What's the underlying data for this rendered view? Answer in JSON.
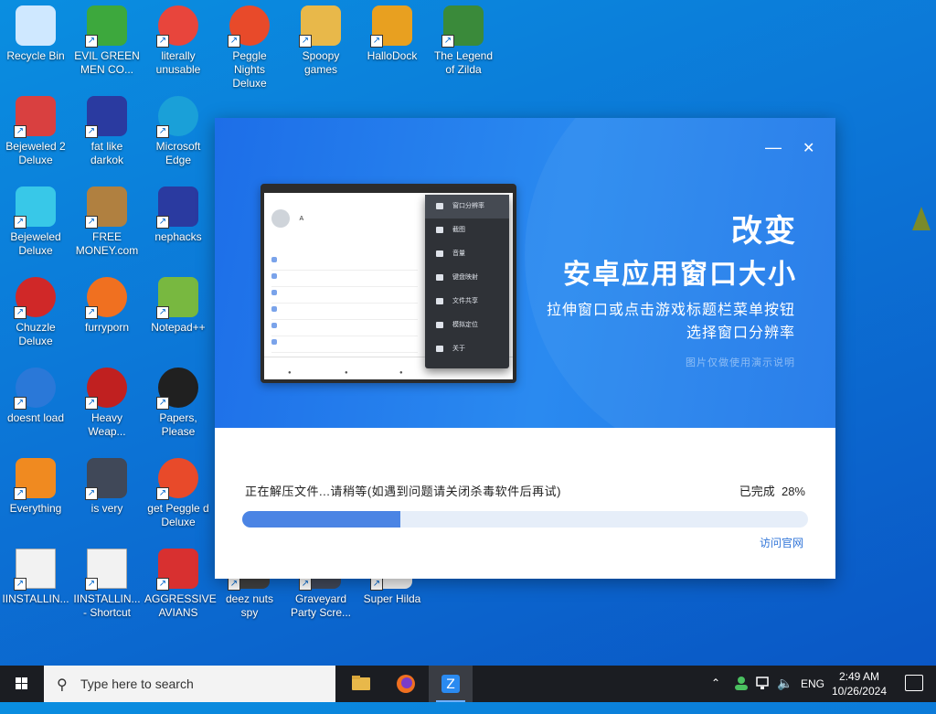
{
  "desktop_icons": [
    {
      "label": "Recycle Bin",
      "icon": "recycle-bin-icon",
      "color": "#cfe8ff"
    },
    {
      "label": "EVIL GREEN MEN CO...",
      "icon": "green-men-icon",
      "color": "#3da83d"
    },
    {
      "label": "literally unusable",
      "icon": "chrome-icon",
      "color": "#e8453c"
    },
    {
      "label": "Peggle Nights Deluxe",
      "icon": "peggle-icon",
      "color": "#e84a2a"
    },
    {
      "label": "Spoopy games",
      "icon": "folder-icon",
      "color": "#e8b84a"
    },
    {
      "label": "HalloDock",
      "icon": "shield-icon",
      "color": "#e8a020"
    },
    {
      "label": "The Legend of Zilda",
      "icon": "zelda-icon",
      "color": "#3a8a3a"
    },
    {
      "label": "Bejeweled 2 Deluxe",
      "icon": "bejeweled2-icon",
      "color": "#d94040"
    },
    {
      "label": "fat like darkok",
      "icon": "mpi-icon",
      "color": "#2a3aa0"
    },
    {
      "label": "Microsoft Edge",
      "icon": "edge-icon",
      "color": "#1aa0d8"
    },
    {
      "label": "Bejeweled Deluxe",
      "icon": "gem-icon",
      "color": "#38c8e8"
    },
    {
      "label": "FREE MONEY.com",
      "icon": "money-bag-icon",
      "color": "#b08040"
    },
    {
      "label": "nephacks",
      "icon": "mpi-icon",
      "color": "#2a3aa0"
    },
    {
      "label": "Chuzzle Deluxe",
      "icon": "chuzzle-icon",
      "color": "#d02828"
    },
    {
      "label": "furryporn",
      "icon": "firefox-icon",
      "color": "#f07020"
    },
    {
      "label": "Notepad++",
      "icon": "notepadpp-icon",
      "color": "#78b840"
    },
    {
      "label": "doesnt load",
      "icon": "thunderbird-icon",
      "color": "#2a78d8"
    },
    {
      "label": "Heavy Weap...",
      "icon": "radiation-icon",
      "color": "#c02020"
    },
    {
      "label": "Papers, Please",
      "icon": "papers-please-icon",
      "color": "#202020"
    },
    {
      "label": "Everything",
      "icon": "search-magnifier-icon",
      "color": "#f08a20"
    },
    {
      "label": "is very",
      "icon": "mpi-shield-icon",
      "color": "#404858"
    },
    {
      "label": "get Peggle d Deluxe",
      "icon": "peggle-icon",
      "color": "#e84a2a"
    },
    {
      "label": "IINSTALLIN...",
      "icon": "text-file-icon",
      "color": "#f2f2f2"
    },
    {
      "label": "IINSTALLIN... - Shortcut",
      "icon": "text-file-icon",
      "color": "#f2f2f2"
    },
    {
      "label": "AGGRESSIVE AVIANS",
      "icon": "angry-bird-icon",
      "color": "#d83030"
    },
    {
      "label": "deez nuts spy",
      "icon": "spy-icon",
      "color": "#404040"
    },
    {
      "label": "Graveyard Party Scre...",
      "icon": "graveyard-icon",
      "color": "#404858"
    },
    {
      "label": "Super Hilda",
      "icon": "hilda-icon",
      "color": "#f0f0f0"
    }
  ],
  "installer": {
    "minimize": "—",
    "close": "✕",
    "hero_title_1": "改变",
    "hero_title_2": "安卓应用窗口大小",
    "hero_desc_1": "拉伸窗口或点击游戏标题栏菜单按钮",
    "hero_desc_2": "选择窗口分辨率",
    "hero_note": "图片仅做使用演示说明",
    "mock_profile_name": "A",
    "mock_menu": [
      "窗口分辨率",
      "截图",
      "音量",
      "键盘映射",
      "文件共享",
      "模拟定位",
      "关于"
    ],
    "status_text": "正在解压文件...请稍等(如遇到问题请关闭杀毒软件后再试)",
    "done_label": "已完成",
    "progress_percent": "28%",
    "progress": 0.28,
    "link_label": "访问官网",
    "accent": "#4b84e4"
  },
  "taskbar": {
    "search_placeholder": "Type here to search",
    "lang": "ENG",
    "time": "2:49 AM",
    "date": "10/26/2024"
  }
}
